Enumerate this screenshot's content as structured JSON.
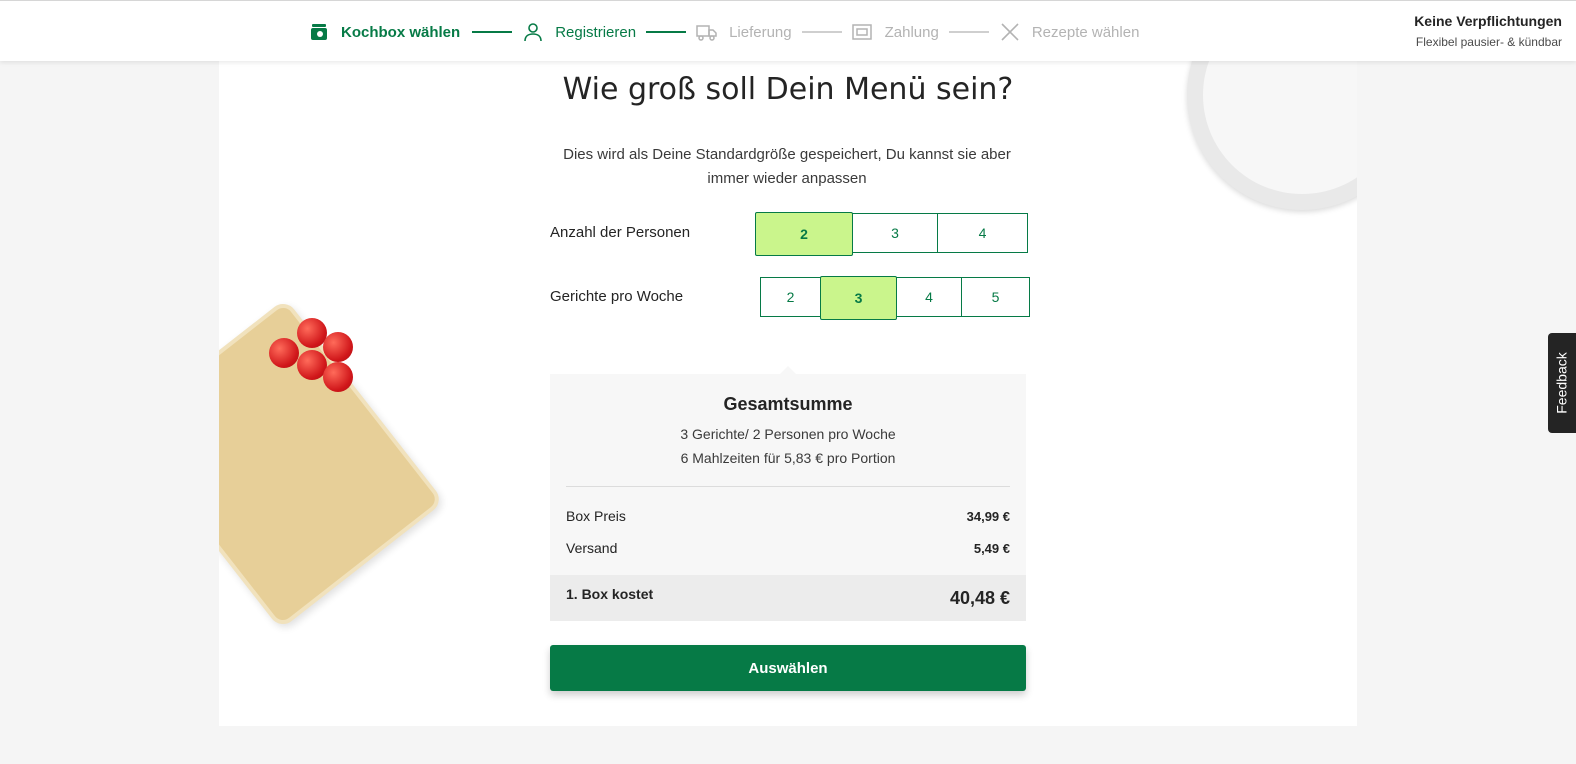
{
  "header": {
    "steps": [
      {
        "label": "Kochbox wählen",
        "state": "done",
        "icon": "box-icon"
      },
      {
        "label": "Registrieren",
        "state": "current",
        "icon": "user-icon"
      },
      {
        "label": "Lieferung",
        "state": "todo",
        "icon": "truck-icon"
      },
      {
        "label": "Zahlung",
        "state": "todo",
        "icon": "wallet-icon"
      },
      {
        "label": "Rezepte wählen",
        "state": "todo",
        "icon": "cutlery-icon"
      }
    ],
    "commitment_title": "Keine Verpflichtungen",
    "commitment_sub": "Flexibel pausier- & kündbar"
  },
  "main": {
    "title": "Wie groß soll Dein Menü sein?",
    "subtitle": "Dies wird als Deine Standardgröße gespeichert, Du kannst sie aber immer wieder anpassen",
    "persons": {
      "label": "Anzahl der Personen",
      "options": [
        "2",
        "3",
        "4"
      ],
      "selected": "2"
    },
    "meals": {
      "label": "Gerichte pro Woche",
      "options": [
        "2",
        "3",
        "4",
        "5"
      ],
      "selected": "3"
    },
    "summary": {
      "title": "Gesamtsumme",
      "line1": "3 Gerichte/ 2 Personen pro Woche",
      "line2": "6 Mahlzeiten für 5,83 € pro Portion",
      "box_price_label": "Box Preis",
      "box_price_value": "34,99 €",
      "shipping_label": "Versand",
      "shipping_value": "5,49 €",
      "total_label": "1. Box kostet",
      "total_value": "40,48 €"
    },
    "cta_label": "Auswählen"
  },
  "feedback_label": "Feedback",
  "colors": {
    "brand_green": "#067a46",
    "selected_bg": "#caf58c",
    "muted": "#b3b3b3"
  }
}
